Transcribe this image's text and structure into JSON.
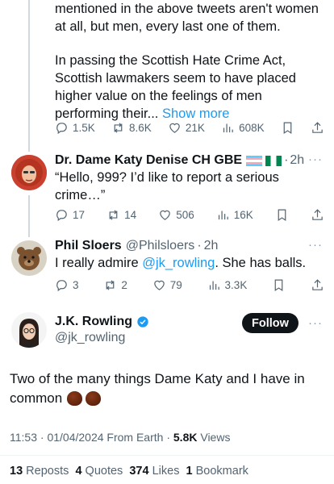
{
  "tweet1": {
    "line1": "mentioned in the above tweets aren't women",
    "line2": "at all, but men, every last one of them.",
    "para2_line1": "In passing the Scottish Hate Crime Act,",
    "para2_line2": "Scottish lawmakers seem to have placed",
    "para2_line3": "higher value on the feelings of men",
    "para2_line4": "performing their...",
    "show_more": "Show more",
    "replies": "1.5K",
    "reposts": "8.6K",
    "likes": "21K",
    "views": "608K"
  },
  "tweet2": {
    "name": "Dr. Dame Katy Denise CH GBE",
    "time": "2h",
    "line1": "“Hello, 999? I’d like to report a serious",
    "line2": "crime…”",
    "replies": "17",
    "reposts": "14",
    "likes": "506",
    "views": "16K"
  },
  "tweet3": {
    "name": "Phil Sloers",
    "handle": "@Philsloers",
    "time": "2h",
    "text_pre": "I really admire ",
    "mention": "@jk_rowling",
    "text_post": ". She has balls.",
    "replies": "3",
    "reposts": "2",
    "likes": "79",
    "views": "3.3K"
  },
  "main": {
    "name": "J.K. Rowling",
    "handle": "@jk_rowling",
    "follow": "Follow",
    "text_line1": "Two of the many things Dame Katy and I have in",
    "text_line2": "common",
    "time": "11:53",
    "date": "01/04/2024",
    "source": "From Earth",
    "views_count": "5.8K",
    "views_label": "Views",
    "reposts_count": "13",
    "reposts_label": "Reposts",
    "quotes_count": "4",
    "quotes_label": "Quotes",
    "likes_count": "374",
    "likes_label": "Likes",
    "bookmarks_count": "1",
    "bookmarks_label": "Bookmark"
  },
  "colors": {
    "accent": "#1d9bf0",
    "text": "#0f1419",
    "muted": "#536471"
  }
}
